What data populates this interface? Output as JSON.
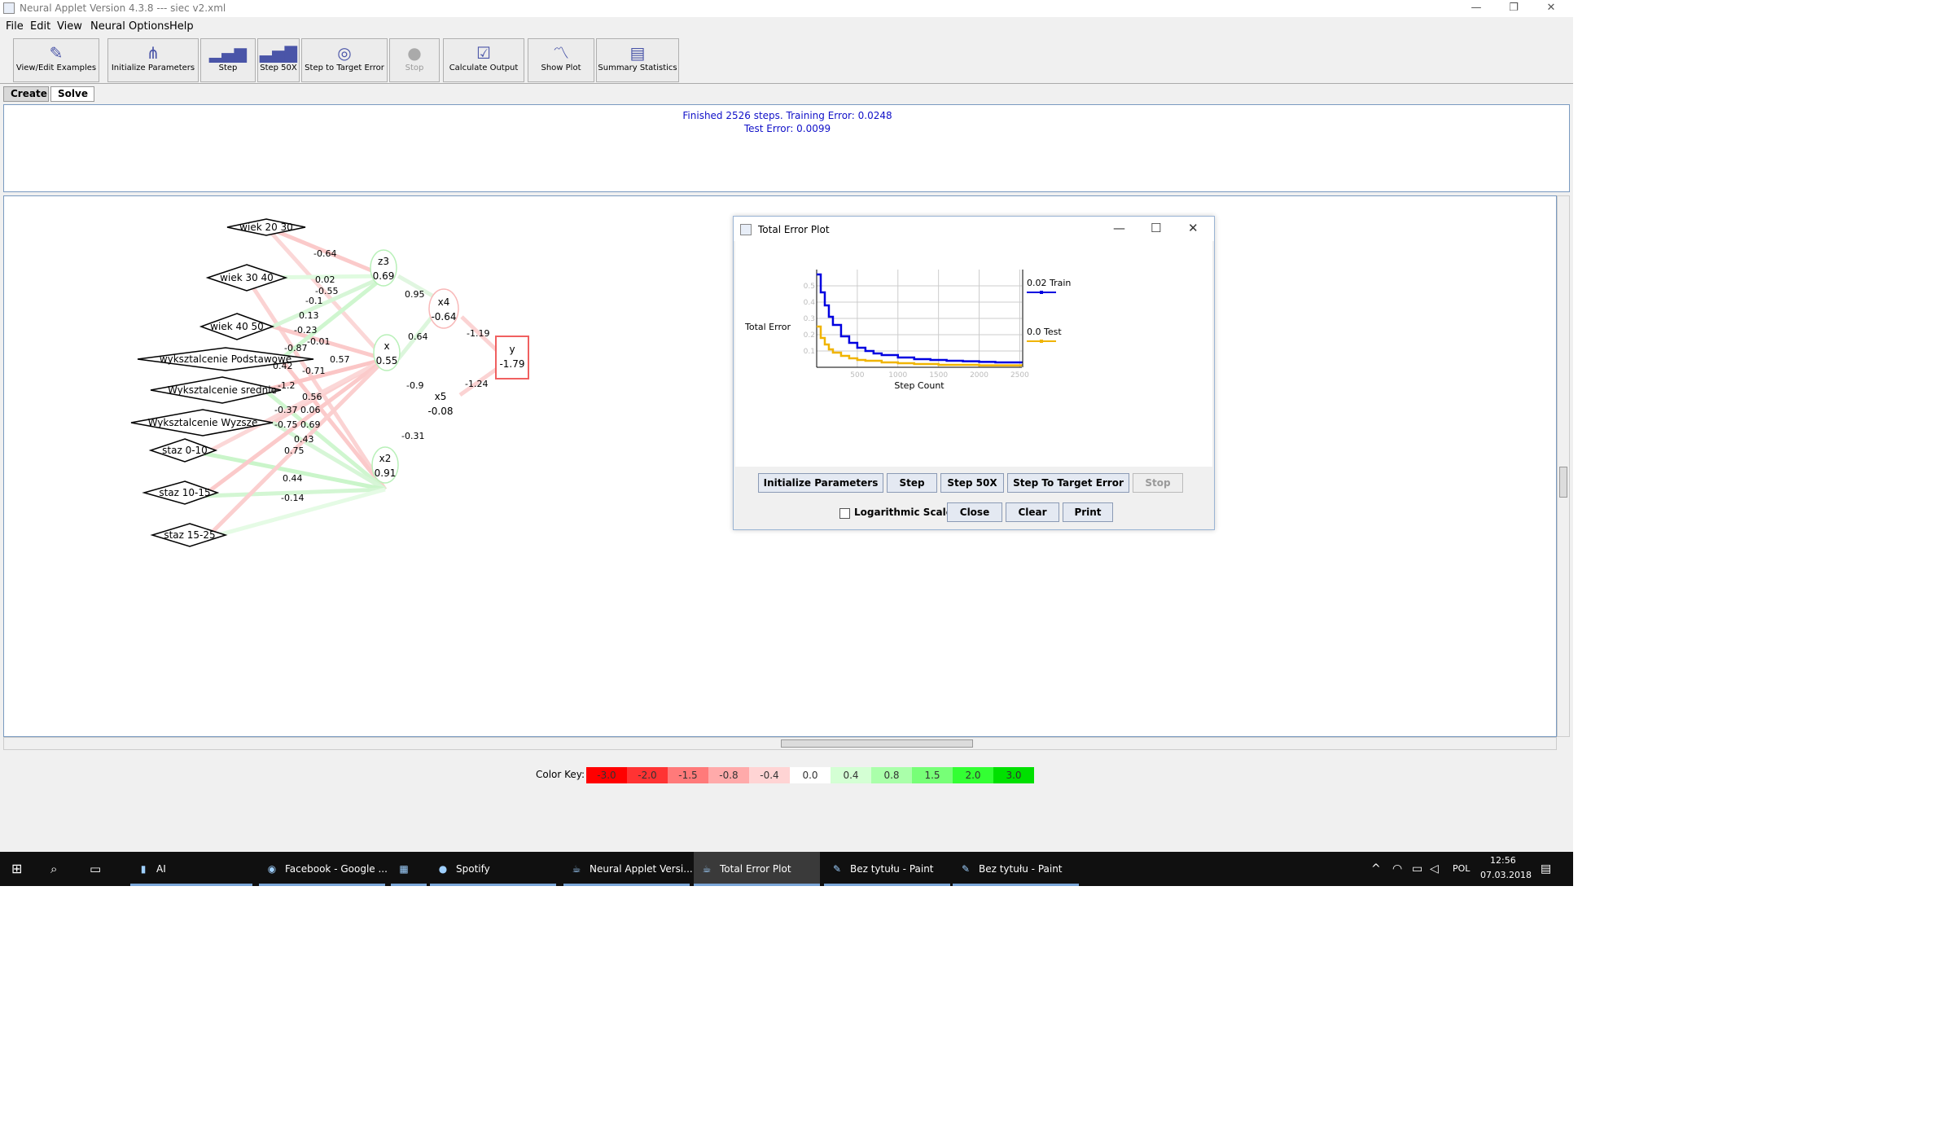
{
  "window": {
    "title": "Neural Applet Version 4.3.8 --- siec v2.xml"
  },
  "window_controls": {
    "minimize": "—",
    "restore": "❐",
    "close": "✕"
  },
  "menu": [
    "File",
    "Edit",
    "View",
    "Neural Options",
    "Help"
  ],
  "toolbar": [
    {
      "label": "View/Edit Examples",
      "icon": "edit-icon",
      "enabled": true
    },
    {
      "label": "Initialize Parameters",
      "icon": "network-icon",
      "enabled": true
    },
    {
      "label": "Step",
      "icon": "bars-icon",
      "enabled": true
    },
    {
      "label": "Step 50X",
      "icon": "bars-icon",
      "enabled": true
    },
    {
      "label": "Step to Target Error",
      "icon": "target-icon",
      "enabled": true
    },
    {
      "label": "Stop",
      "icon": "stop-icon",
      "enabled": false
    },
    {
      "label": "Calculate Output",
      "icon": "checklist-icon",
      "enabled": true
    },
    {
      "label": "Show Plot",
      "icon": "plot-icon",
      "enabled": true
    },
    {
      "label": "Summary Statistics",
      "icon": "stats-icon",
      "enabled": true
    }
  ],
  "tabs": [
    "Create",
    "Solve"
  ],
  "status": {
    "line1": "Finished 2526 steps.  Training Error: 0.0248",
    "line2": "Test Error: 0.0099"
  },
  "network": {
    "inputs": [
      "wiek 20 30",
      "wiek 30 40",
      "wiek 40 50",
      "wyksztalcenie Podstawowe",
      "Wyksztalcenie srednie",
      "Wyksztalcenie Wyzsze",
      "staz 0-10",
      "staz 10-15",
      "staz 15-25"
    ],
    "hidden": [
      {
        "name": "z3",
        "value": "0.69"
      },
      {
        "name": "x",
        "value": "0.55"
      },
      {
        "name": "x2",
        "value": "0.91"
      },
      {
        "name": "x4",
        "value": "-0.64"
      },
      {
        "name": "x5",
        "value": "-0.08"
      }
    ],
    "output": {
      "name": "y",
      "value": "-1.79"
    },
    "weight_labels": [
      "-0.64",
      "0.02",
      "-0.55",
      "-0.1",
      "0.13",
      "-0.23",
      "-0.01",
      "-0.87",
      "0.57",
      "0.42",
      "-0.71",
      "-1.2",
      "0.56",
      "-0.37",
      "0.06",
      "-0.75",
      "0.69",
      "0.43",
      "0.75",
      "0.44",
      "-0.14",
      "0.95",
      "0.64",
      "-0.9",
      "-0.31",
      "-1.19",
      "-1.24"
    ]
  },
  "color_key": {
    "label": "Color Key:",
    "cells": [
      {
        "value": "-3.0",
        "color": "#ff0000"
      },
      {
        "value": "-2.0",
        "color": "#ff3333"
      },
      {
        "value": "-1.5",
        "color": "#ff7a7a"
      },
      {
        "value": "-0.8",
        "color": "#ffaaaa"
      },
      {
        "value": "-0.4",
        "color": "#ffd4d4"
      },
      {
        "value": "0.0",
        "color": "#ffffff"
      },
      {
        "value": "0.4",
        "color": "#d4ffd4"
      },
      {
        "value": "0.8",
        "color": "#aaffaa"
      },
      {
        "value": "1.5",
        "color": "#77ff77"
      },
      {
        "value": "2.0",
        "color": "#33ff33"
      },
      {
        "value": "3.0",
        "color": "#00e000"
      }
    ]
  },
  "plot_window": {
    "title": "Total Error Plot",
    "controls": {
      "minimize": "—",
      "maximize": "☐",
      "close": "✕"
    },
    "buttons": [
      {
        "label": "Initialize Parameters",
        "enabled": true
      },
      {
        "label": "Step",
        "enabled": true
      },
      {
        "label": "Step 50X",
        "enabled": true
      },
      {
        "label": "Step To Target Error",
        "enabled": true
      },
      {
        "label": "Stop",
        "enabled": false
      }
    ],
    "log_scale_label": "Logarithmic Scale",
    "log_scale_checked": false,
    "close_label": "Close",
    "clear_label": "Clear",
    "print_label": "Print"
  },
  "chart_data": {
    "type": "line",
    "title": "",
    "xlabel": "Step Count",
    "ylabel": "Total Error",
    "xlim": [
      0,
      2526
    ],
    "ylim": [
      0,
      0.6
    ],
    "x_ticks": [
      "500",
      "1000",
      "1500",
      "2000",
      "2500"
    ],
    "y_ticks": [
      "0.1",
      "0.2",
      "0.3",
      "0.4",
      "0.5"
    ],
    "grid": true,
    "legend_position": "right",
    "series": [
      {
        "name": "Train",
        "legend": "0.02 Train",
        "color": "#0000e0",
        "x": [
          0,
          50,
          100,
          150,
          200,
          300,
          400,
          500,
          600,
          700,
          800,
          1000,
          1200,
          1400,
          1600,
          1800,
          2000,
          2200,
          2526
        ],
        "y": [
          0.57,
          0.46,
          0.38,
          0.31,
          0.26,
          0.19,
          0.15,
          0.12,
          0.1,
          0.085,
          0.075,
          0.06,
          0.05,
          0.045,
          0.04,
          0.037,
          0.033,
          0.03,
          0.025
        ]
      },
      {
        "name": "Test",
        "legend": "0.0 Test",
        "color": "#f0b400",
        "x": [
          0,
          50,
          100,
          150,
          200,
          300,
          400,
          500,
          600,
          800,
          1000,
          1200,
          1500,
          2000,
          2526
        ],
        "y": [
          0.25,
          0.18,
          0.14,
          0.11,
          0.09,
          0.07,
          0.055,
          0.045,
          0.04,
          0.03,
          0.025,
          0.02,
          0.015,
          0.012,
          0.01
        ]
      }
    ]
  },
  "taskbar": {
    "items": [
      {
        "label": "AI",
        "icon": "folder-icon",
        "active": false
      },
      {
        "label": "Facebook - Google ...",
        "icon": "chrome-icon",
        "active": false
      },
      {
        "label": "",
        "icon": "app-icon",
        "active": false
      },
      {
        "label": "Spotify",
        "icon": "spotify-icon",
        "active": false
      },
      {
        "label": "Neural Applet Versi...",
        "icon": "java-icon",
        "active": false
      },
      {
        "label": "Total Error Plot",
        "icon": "java-icon",
        "active": true
      },
      {
        "label": "Bez tytułu - Paint",
        "icon": "paint-icon",
        "active": false
      },
      {
        "label": "Bez tytułu - Paint",
        "icon": "paint-icon",
        "active": false
      }
    ],
    "lang": "POL",
    "time": "12:56",
    "date": "07.03.2018"
  }
}
